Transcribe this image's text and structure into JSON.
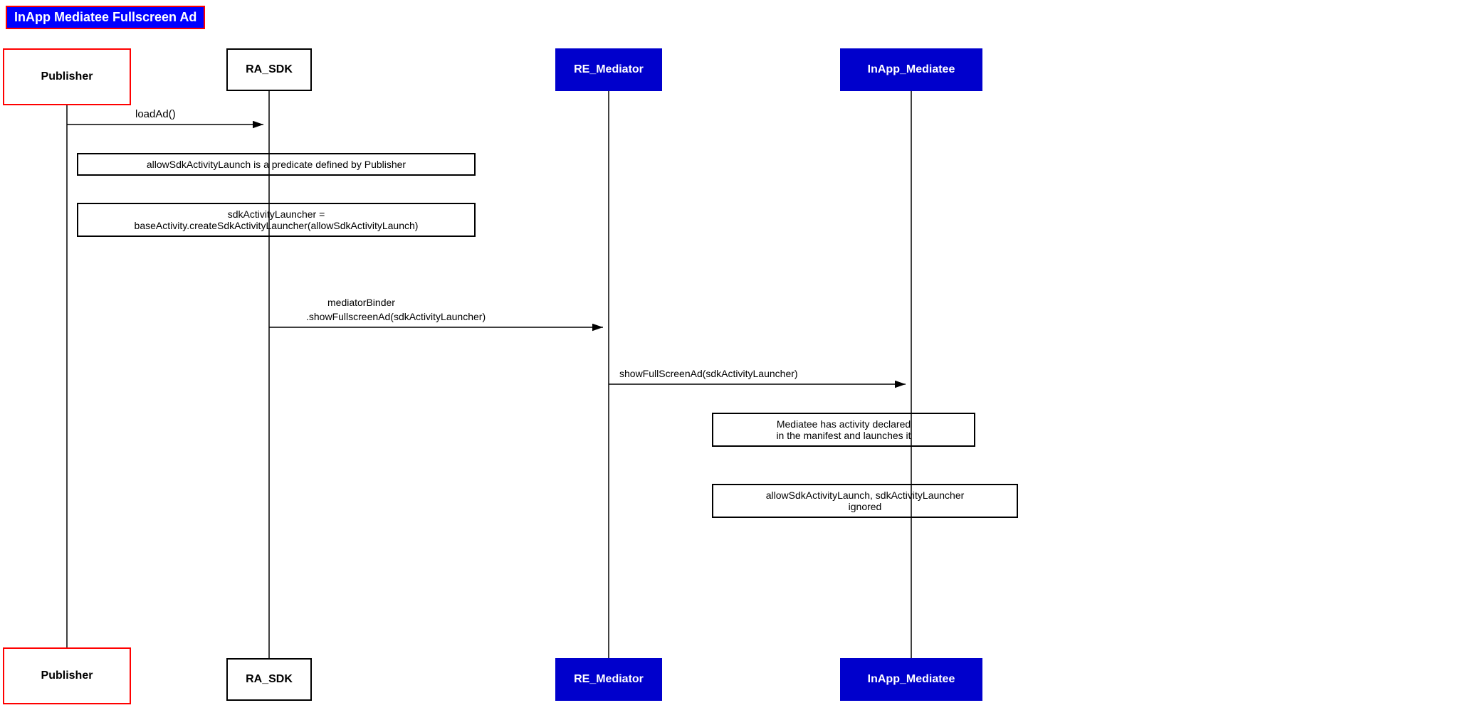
{
  "title": "InApp Mediatee Fullscreen Ad",
  "actors": {
    "publisher_label": "Publisher",
    "rasdk_label": "RA_SDK",
    "remediator_label": "RE_Mediator",
    "inapp_label": "InApp_Mediatee"
  },
  "notes": {
    "allow_predicate": "allowSdkActivityLaunch is a predicate defined by Publisher",
    "sdk_launcher_line1": "sdkActivityLauncher =",
    "sdk_launcher_line2": "baseActivity.createSdkActivityLauncher(allowSdkActivityLaunch)",
    "mediatee_activity_line1": "Mediatee has activity declared",
    "mediatee_activity_line2": "in the manifest and launches it",
    "ignored_line1": "allowSdkActivityLaunch, sdkActivityLauncher",
    "ignored_line2": "ignored"
  },
  "arrows": {
    "load_ad": "loadAd()",
    "mediator_binder_line1": "mediatorBinder",
    "mediator_binder_line2": ".showFullscreenAd(sdkActivityLauncher)",
    "show_fullscreen": "showFullScreenAd(sdkActivityLauncher)"
  }
}
